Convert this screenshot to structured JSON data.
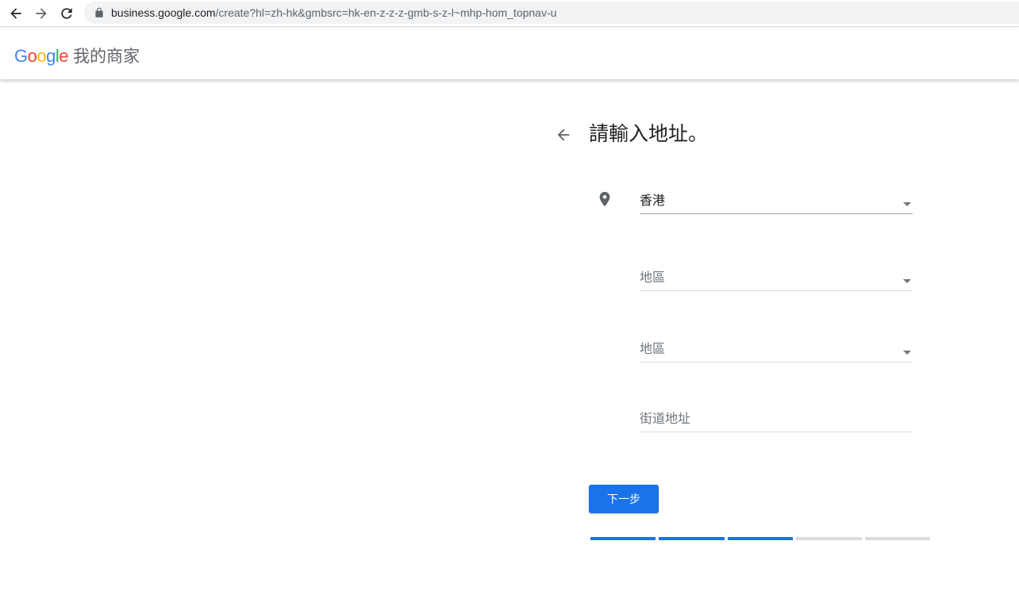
{
  "browser": {
    "url_host": "business.google.com",
    "url_path": "/create?hl=zh-hk&gmbsrc=hk-en-z-z-z-gmb-s-z-l~mhp-hom_topnav-u",
    "icons": [
      "back-arrow-icon",
      "forward-arrow-icon",
      "reload-icon",
      "lock-icon"
    ]
  },
  "header": {
    "logo_letters": [
      "G",
      "o",
      "o",
      "g",
      "l",
      "e"
    ],
    "product_name": "我的商家"
  },
  "form": {
    "title": "請輸入地址。",
    "country": {
      "value": "香港"
    },
    "region_primary": {
      "placeholder": "地區"
    },
    "region_secondary": {
      "placeholder": "地區"
    },
    "street": {
      "placeholder": "街道地址"
    },
    "next_label": "下一步"
  },
  "progress": {
    "total_steps": 5,
    "completed_steps": 3
  },
  "colors": {
    "accent": "#1a73e8",
    "inactive": "#dadce0"
  }
}
